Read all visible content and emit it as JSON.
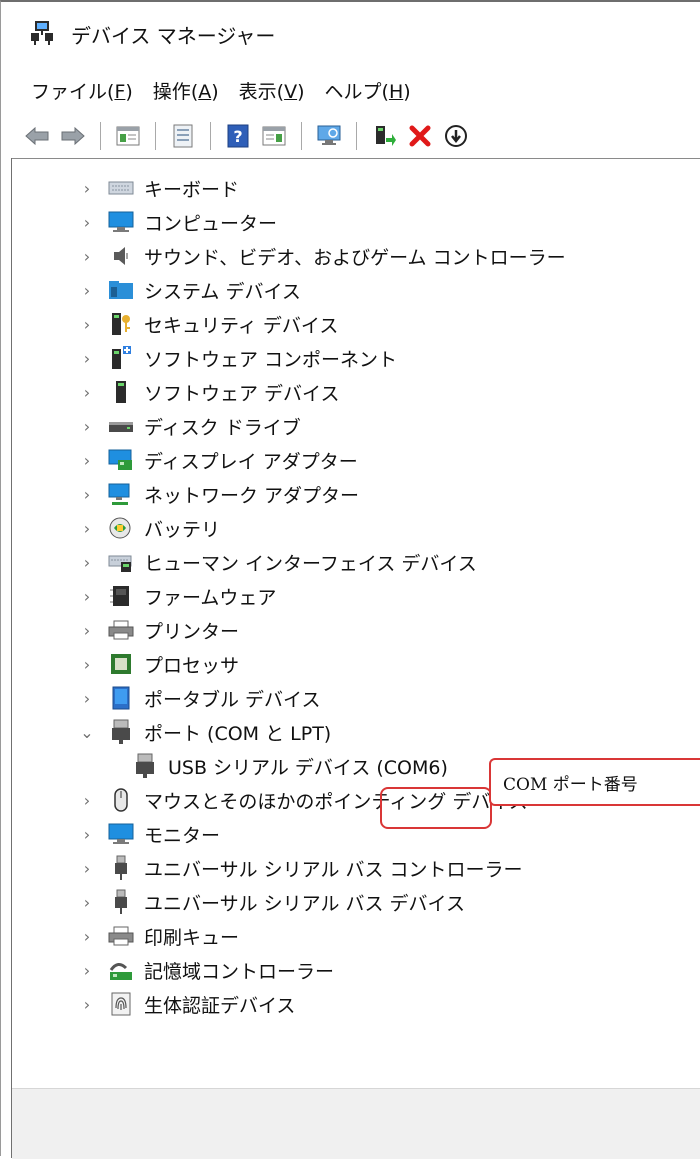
{
  "window": {
    "title": "デバイス マネージャー"
  },
  "menu": [
    {
      "label": "ファイル",
      "accel": "F"
    },
    {
      "label": "操作",
      "accel": "A"
    },
    {
      "label": "表示",
      "accel": "V"
    },
    {
      "label": "ヘルプ",
      "accel": "H"
    }
  ],
  "toolbar": {
    "buttons": [
      "back-arrow-icon",
      "forward-arrow-icon",
      "show-hide-console-tree-icon",
      "properties-icon",
      "help-icon",
      "show-hide-action-pane-icon",
      "scan-hardware-changes-icon",
      "update-driver-icon",
      "uninstall-device-icon",
      "disable-device-icon"
    ]
  },
  "tree": {
    "items": [
      {
        "label": "キーボード",
        "expanded": false,
        "icon": "keyboard-icon"
      },
      {
        "label": "コンピューター",
        "expanded": false,
        "icon": "computer-icon"
      },
      {
        "label": "サウンド、ビデオ、およびゲーム コントローラー",
        "expanded": false,
        "icon": "speaker-icon"
      },
      {
        "label": "システム デバイス",
        "expanded": false,
        "icon": "system-folder-icon"
      },
      {
        "label": "セキュリティ デバイス",
        "expanded": false,
        "icon": "security-key-icon"
      },
      {
        "label": "ソフトウェア コンポーネント",
        "expanded": false,
        "icon": "software-component-icon"
      },
      {
        "label": "ソフトウェア デバイス",
        "expanded": false,
        "icon": "software-device-icon"
      },
      {
        "label": "ディスク ドライブ",
        "expanded": false,
        "icon": "disk-drive-icon"
      },
      {
        "label": "ディスプレイ アダプター",
        "expanded": false,
        "icon": "display-adapter-icon"
      },
      {
        "label": "ネットワーク アダプター",
        "expanded": false,
        "icon": "network-adapter-icon"
      },
      {
        "label": "バッテリ",
        "expanded": false,
        "icon": "battery-icon"
      },
      {
        "label": "ヒューマン インターフェイス デバイス",
        "expanded": false,
        "icon": "hid-icon"
      },
      {
        "label": "ファームウェア",
        "expanded": false,
        "icon": "firmware-icon"
      },
      {
        "label": "プリンター",
        "expanded": false,
        "icon": "printer-icon"
      },
      {
        "label": "プロセッサ",
        "expanded": false,
        "icon": "processor-icon"
      },
      {
        "label": "ポータブル デバイス",
        "expanded": false,
        "icon": "portable-device-icon"
      },
      {
        "label": "ポート (COM と LPT)",
        "expanded": true,
        "icon": "port-icon"
      },
      {
        "label": "USB シリアル デバイス (COM6)",
        "child": true,
        "icon": "usb-serial-icon"
      },
      {
        "label": "マウスとそのほかのポインティング デバイス",
        "expanded": false,
        "icon": "mouse-icon"
      },
      {
        "label": "モニター",
        "expanded": false,
        "icon": "monitor-icon"
      },
      {
        "label": "ユニバーサル シリアル バス コントローラー",
        "expanded": false,
        "icon": "usb-controller-icon"
      },
      {
        "label": "ユニバーサル シリアル バス デバイス",
        "expanded": false,
        "icon": "usb-device-icon"
      },
      {
        "label": "印刷キュー",
        "expanded": false,
        "icon": "print-queue-icon"
      },
      {
        "label": "記憶域コントローラー",
        "expanded": false,
        "icon": "storage-controller-icon"
      },
      {
        "label": "生体認証デバイス",
        "expanded": false,
        "icon": "biometric-icon"
      }
    ]
  },
  "annotation": {
    "text": "COM ポート番号"
  },
  "colors": {
    "annotation_border": "#d93636",
    "selection_blue": "#1e78d7"
  }
}
